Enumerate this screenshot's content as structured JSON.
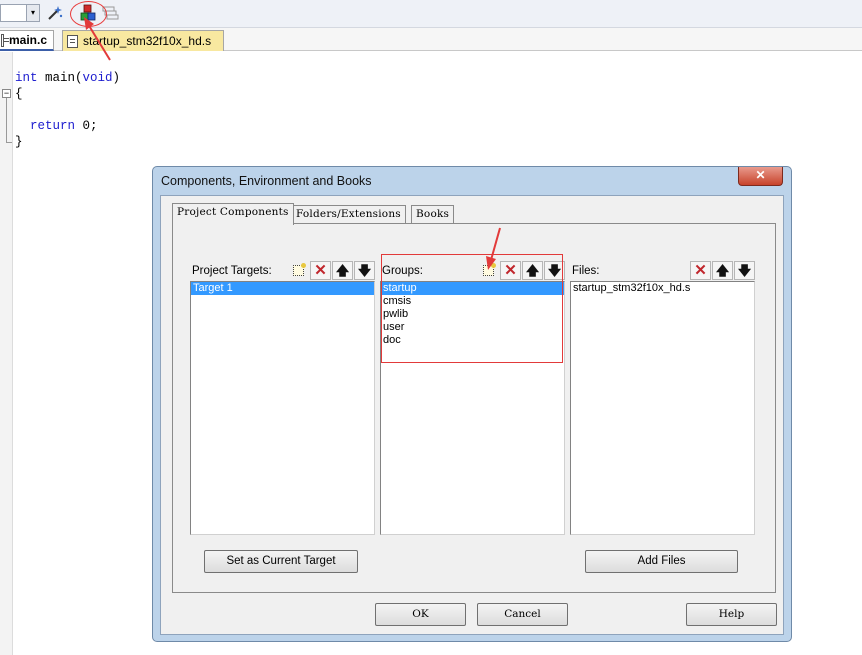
{
  "toolbar": {
    "combo_arrow": "▾",
    "icons": [
      "magic-wand-icon",
      "manage-project-items-icon",
      "stacked-windows-icon"
    ]
  },
  "tabs": [
    {
      "label": "main.c"
    },
    {
      "label": "startup_stm32f10x_hd.s"
    }
  ],
  "editor": {
    "lines": [
      "int main(void)",
      "{",
      "",
      "  return 0;",
      "}"
    ],
    "fold_symbol": "−"
  },
  "dialog": {
    "title": "Components, Environment and Books",
    "close_symbol": "✕",
    "tabs": [
      "Project Components",
      "Folders/Extensions",
      "Books"
    ],
    "active_tab": 0,
    "targets": {
      "label": "Project Targets:",
      "items": [
        "Target 1"
      ],
      "selected": 0
    },
    "groups": {
      "label": "Groups:",
      "items": [
        "startup",
        "cmsis",
        "pwlib",
        "user",
        "doc"
      ],
      "selected": 0
    },
    "files": {
      "label": "Files:",
      "items": [
        "startup_stm32f10x_hd.s"
      ]
    },
    "buttons": {
      "set_current_target": "Set as Current Target",
      "add_files": "Add Files",
      "ok": "OK",
      "cancel": "Cancel",
      "help": "Help"
    },
    "toolbar_glyphs": {
      "delete": "✕",
      "up": "🡅",
      "down": "🡇"
    }
  },
  "colors": {
    "selection": "#3399ff",
    "annotation": "#e23a3a",
    "keyword": "#1d1dcf",
    "dialog_frame": "#bcd3ea"
  }
}
